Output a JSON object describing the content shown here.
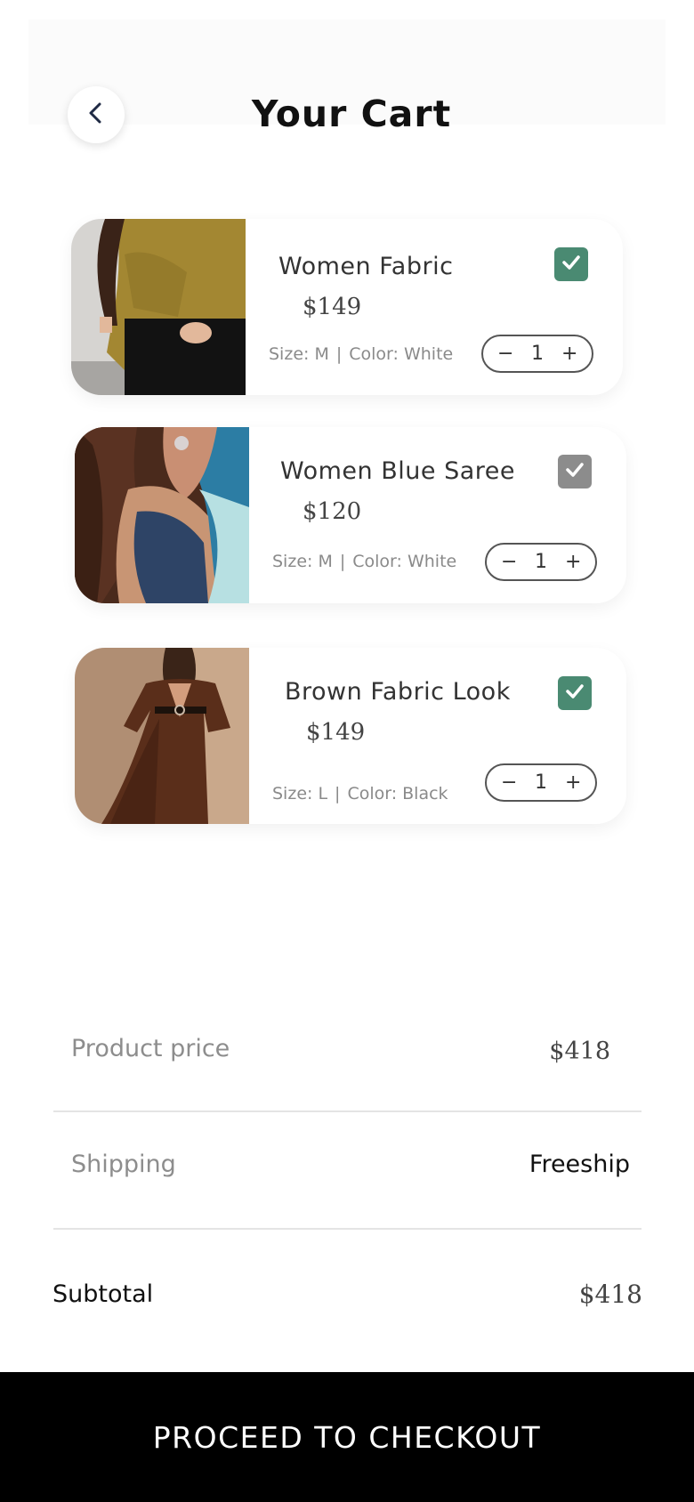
{
  "header": {
    "title": "Your Cart"
  },
  "cart": {
    "items": [
      {
        "name": "Women Fabric",
        "price": "$149",
        "size": "Size: M",
        "color": "Color: White",
        "quantity": "1",
        "checked": true,
        "check_color": "#4a8a72",
        "image": "woman-olive-shirt-photo"
      },
      {
        "name": "Women Blue Saree",
        "price": "$120",
        "size": "Size: M",
        "color": "Color: White",
        "quantity": "1",
        "checked": true,
        "check_color": "#8c8c8c",
        "image": "woman-blue-saree-photo"
      },
      {
        "name": "Brown Fabric Look",
        "price": "$149",
        "size": "Size: L",
        "color": "Color: Black",
        "quantity": "1",
        "checked": true,
        "check_color": "#4a8a72",
        "image": "woman-brown-dress-photo"
      }
    ],
    "stepper": {
      "minus": "−",
      "plus": "+"
    },
    "meta_separator": "|"
  },
  "summary": {
    "product_price_label": "Product price",
    "product_price_value": "$418",
    "shipping_label": "Shipping",
    "shipping_value": "Freeship",
    "subtotal_label": "Subtotal",
    "subtotal_value": "$418"
  },
  "checkout": {
    "label": "PROCEED TO CHECKOUT"
  }
}
